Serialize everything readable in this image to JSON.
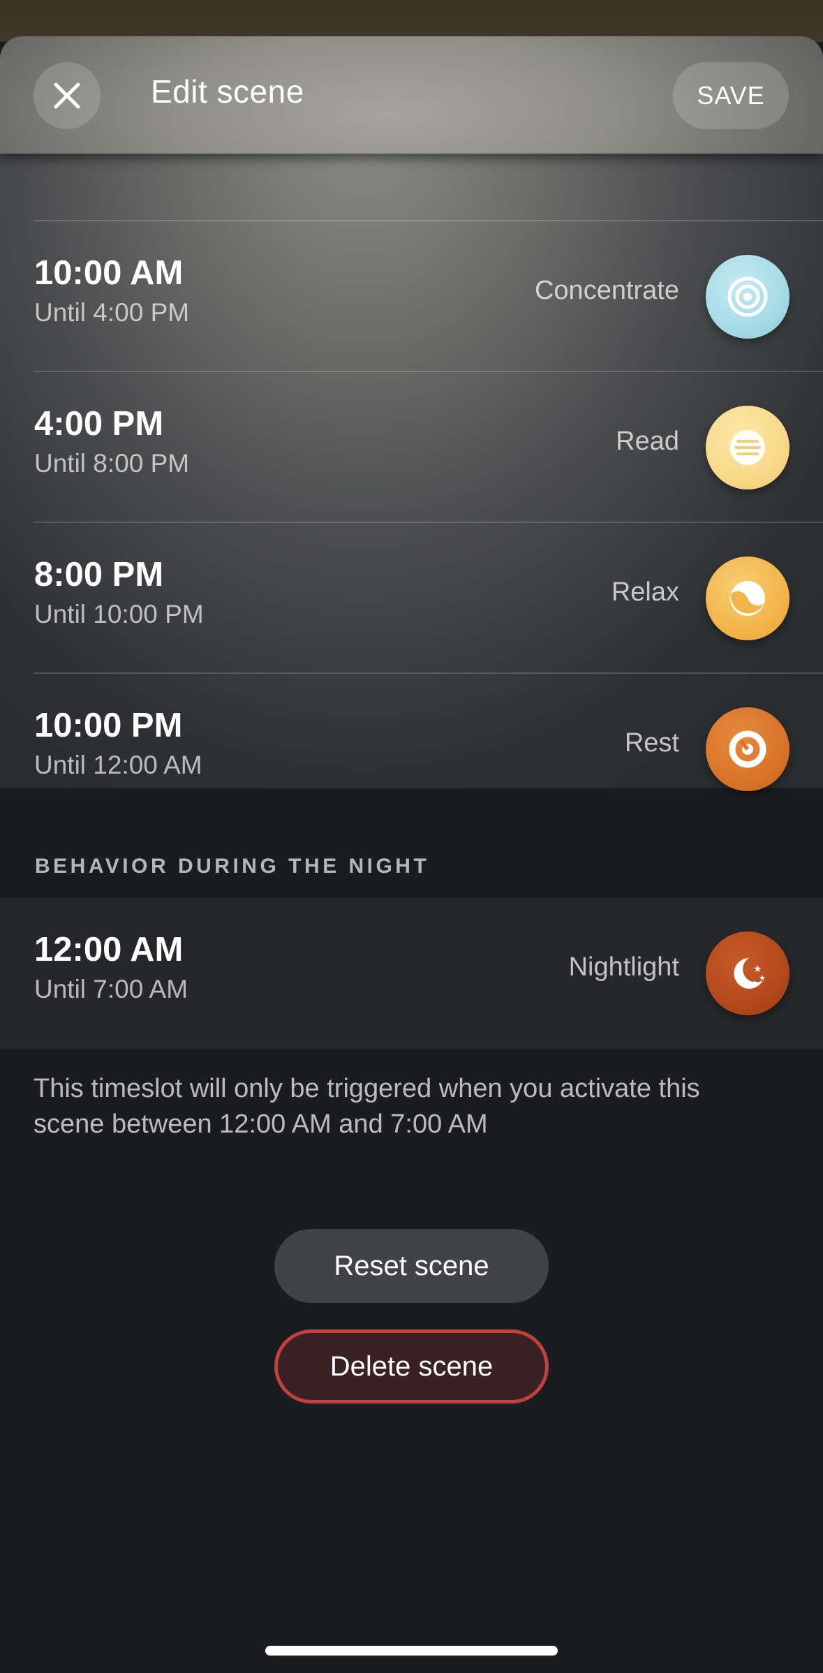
{
  "header": {
    "title": "Edit scene",
    "save_label": "SAVE",
    "close_icon": "close-icon"
  },
  "timeslots": [
    {
      "time": "10:00 AM",
      "until": "Until 4:00 PM",
      "scene": "Concentrate",
      "icon": "concentrate-icon",
      "color": "#a6dbe6"
    },
    {
      "time": "4:00 PM",
      "until": "Until 8:00 PM",
      "scene": "Read",
      "icon": "read-icon",
      "color": "#f8d98a"
    },
    {
      "time": "8:00 PM",
      "until": "Until 10:00 PM",
      "scene": "Relax",
      "icon": "relax-icon",
      "color": "#f2b54a"
    },
    {
      "time": "10:00 PM",
      "until": "Until 12:00 AM",
      "scene": "Rest",
      "icon": "rest-icon",
      "color": "#d9742a"
    }
  ],
  "night": {
    "section_label": "BEHAVIOR DURING THE NIGHT",
    "time": "12:00 AM",
    "until": "Until 7:00 AM",
    "scene": "Nightlight",
    "icon": "nightlight-icon",
    "color": "#b4491c",
    "note": "This timeslot will only be triggered when you activate this scene between 12:00 AM and 7:00 AM"
  },
  "actions": {
    "reset_label": "Reset scene",
    "delete_label": "Delete scene",
    "delete_border_color": "#c2413f"
  }
}
